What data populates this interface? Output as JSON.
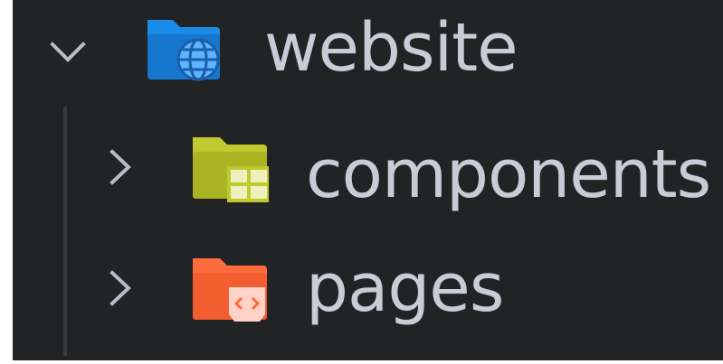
{
  "tree": {
    "items": [
      {
        "label": "website",
        "expanded": true,
        "chevron_icon": "chevron-down-icon",
        "folder_icon": "folder-globe-icon",
        "folder_color": "#1a8be6",
        "badge_color": "#5fb4ff"
      },
      {
        "label": "components",
        "expanded": false,
        "chevron_icon": "chevron-right-icon",
        "folder_icon": "folder-components-icon",
        "folder_color": "#c0c92d",
        "badge_color": "#eef0bd"
      },
      {
        "label": "pages",
        "expanded": false,
        "chevron_icon": "chevron-right-icon",
        "folder_icon": "folder-pages-icon",
        "folder_color": "#ff6b3d",
        "badge_color": "#ffd2c8"
      }
    ]
  },
  "theme": {
    "background": "#222325",
    "text_color": "#c9ccd6",
    "chevron_color": "#b9bcc7",
    "indent_guide_color": "#3a3b3d"
  }
}
